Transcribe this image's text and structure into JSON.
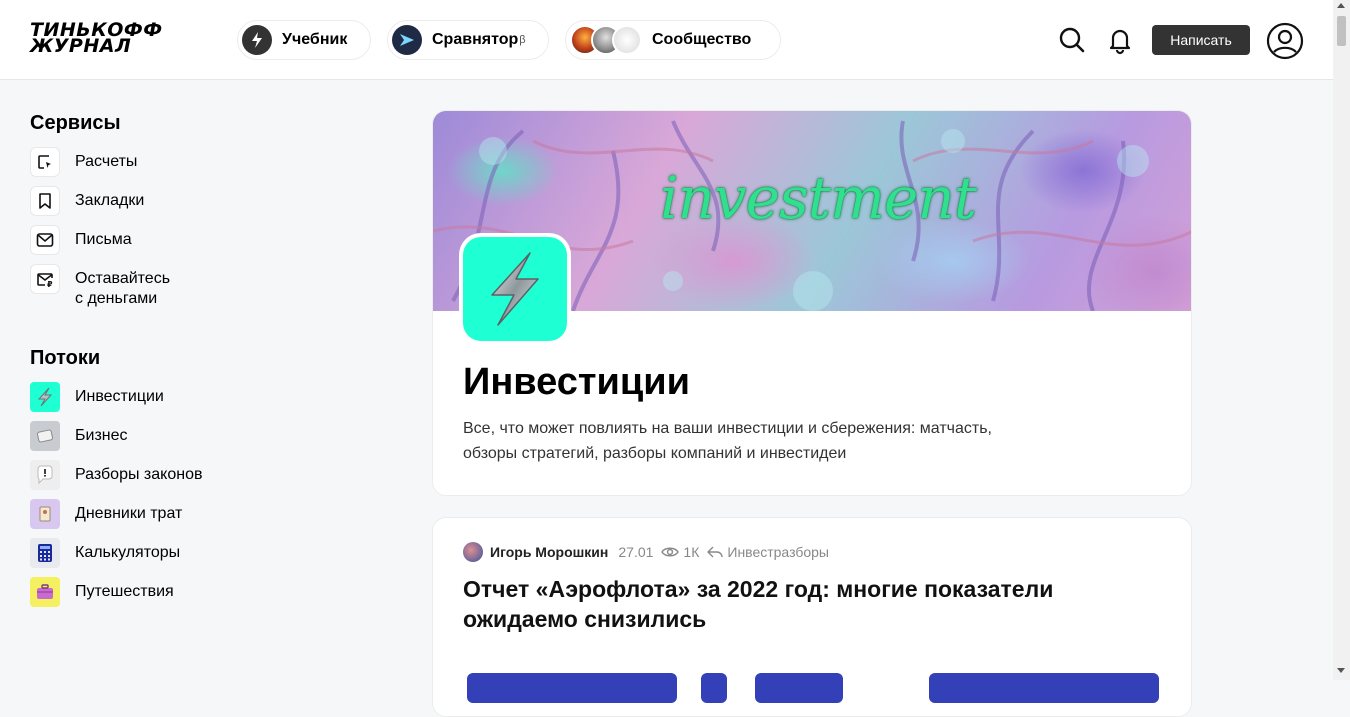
{
  "header": {
    "logo_line1": "ТИНЬКОФФ",
    "logo_line2": "ЖУРНАЛ",
    "nav": [
      {
        "label": "Учебник"
      },
      {
        "label": "Сравнятор",
        "badge": "β"
      },
      {
        "label": "Сообщество"
      }
    ],
    "write_label": "Написать",
    "accent_dark": "#333333"
  },
  "sidebar": {
    "services_title": "Сервисы",
    "services": [
      {
        "label": "Расчеты",
        "icon": "calc-cursor-icon"
      },
      {
        "label": "Закладки",
        "icon": "bookmark-icon"
      },
      {
        "label": "Письма",
        "icon": "mail-icon"
      },
      {
        "label_line1": "Оставайтесь",
        "label_line2": "с деньгами",
        "icon": "money-mail-icon"
      }
    ],
    "streams_title": "Потоки",
    "streams": [
      {
        "label": "Инвестиции",
        "icon": "investments-icon",
        "color": "#1fffd4"
      },
      {
        "label": "Бизнес",
        "icon": "business-icon",
        "color": "#c8ccd0"
      },
      {
        "label": "Разборы законов",
        "icon": "law-icon",
        "color": "#eeeeee"
      },
      {
        "label": "Дневники трат",
        "icon": "diary-icon",
        "color": "#d8c8f0"
      },
      {
        "label": "Калькуляторы",
        "icon": "calculator-icon",
        "color": "#e8eaf0"
      },
      {
        "label": "Путешествия",
        "icon": "travel-icon",
        "color": "#f4f060"
      }
    ]
  },
  "hero": {
    "banner_text": "investment",
    "title": "Инвестиции",
    "description_line1": "Все, что может повлиять на ваши инвестиции и сбережения: матчасть,",
    "description_line2": "обзоры стратегий, разборы компаний и инвестидеи",
    "accent": "#1fffd4"
  },
  "article": {
    "author": "Игорь Морошкин",
    "date": "27.01",
    "views": "1К",
    "section": "Инвестразборы",
    "title_line1": "Отчет «Аэрофлота» за 2022 год: многие показатели",
    "title_line2": "ожидаемо снизились"
  }
}
